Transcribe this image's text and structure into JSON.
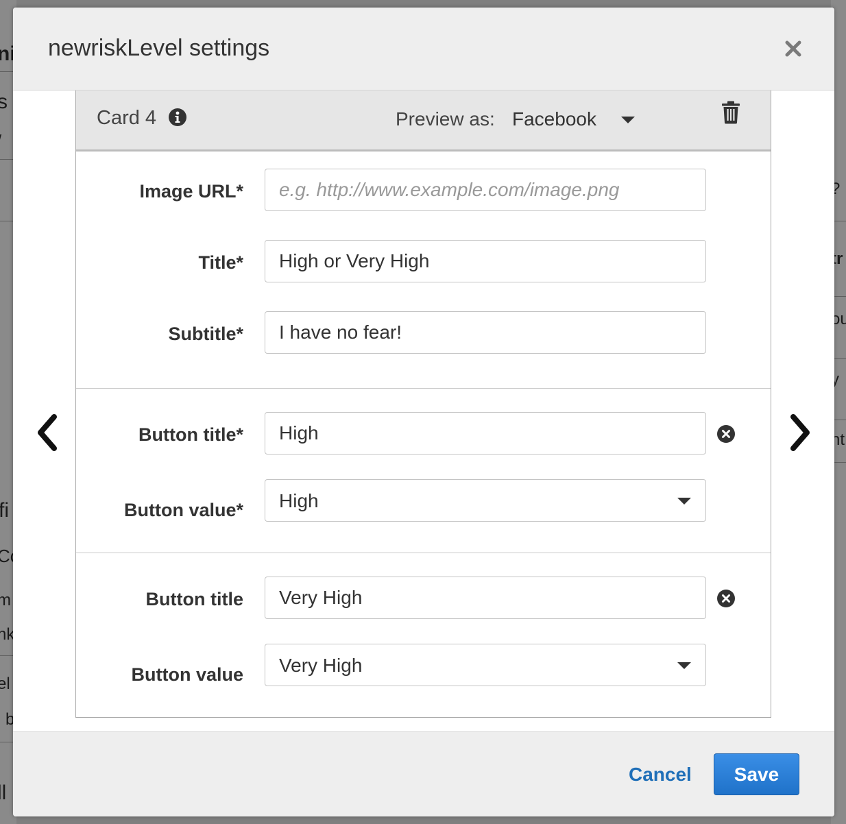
{
  "background": {
    "left_fragments": [
      "ni",
      "s",
      "/",
      "fi",
      "Co",
      "m",
      "nk",
      "el",
      "l b",
      "ll"
    ],
    "right_fragments": [
      "?",
      "tr",
      "ou",
      "y",
      "nt"
    ]
  },
  "modal": {
    "title": "newriskLevel settings",
    "close_icon": "close-icon"
  },
  "navigation": {
    "prev_icon": "chevron-left-icon",
    "next_icon": "chevron-right-icon"
  },
  "card": {
    "title": "Card 4",
    "info_icon": "info-icon",
    "preview_label": "Preview as:",
    "preview_value": "Facebook",
    "delete_icon": "trash-icon"
  },
  "fields": {
    "image_url": {
      "label": "Image URL*",
      "value": "",
      "placeholder": "e.g. http://www.example.com/image.png"
    },
    "title": {
      "label": "Title*",
      "value": "High or Very High"
    },
    "subtitle": {
      "label": "Subtitle*",
      "value": "I have no fear!"
    }
  },
  "buttons": [
    {
      "title_label": "Button title*",
      "title_value": "High",
      "value_label": "Button value*",
      "value_selected": "High"
    },
    {
      "title_label": "Button title",
      "title_value": "Very High",
      "value_label": "Button value",
      "value_selected": "Very High"
    }
  ],
  "footer": {
    "cancel_label": "Cancel",
    "save_label": "Save"
  },
  "colors": {
    "primary": "#1f72c9",
    "link": "#1f6fb8",
    "header_bg": "#eeeeee"
  }
}
